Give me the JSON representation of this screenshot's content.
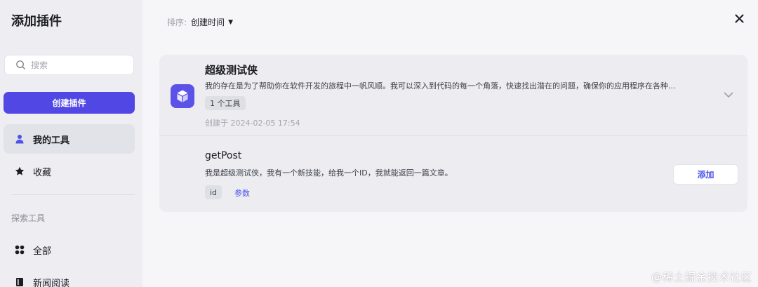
{
  "sidebar": {
    "title": "添加插件",
    "search_placeholder": "搜索",
    "create_button": "创建插件",
    "items": [
      {
        "label": "我的工具",
        "icon": "user-icon",
        "active": true
      },
      {
        "label": "收藏",
        "icon": "star-icon",
        "active": false
      }
    ],
    "section_label": "探索工具",
    "explore_items": [
      {
        "label": "全部",
        "icon": "grid-icon"
      },
      {
        "label": "新闻阅读",
        "icon": "book-icon"
      }
    ]
  },
  "main": {
    "sort_label": "排序:",
    "sort_value": "创建时间",
    "plugin": {
      "name": "超级测试侠",
      "description": "我的存在是为了帮助你在软件开发的旅程中一帆风顺。我可以深入到代码的每一个角落，快速找出潜在的问题，确保你的应用程序在各种...",
      "tool_count": "1 个工具",
      "created": "创建于 2024-02-05 17:54",
      "icon_color": "#5b52e8"
    },
    "tool": {
      "name": "getPost",
      "description": "我是超级测试侠，我有一个新技能，给我一个ID，我就能返回一篇文章。",
      "param": "id",
      "params_link": "参数",
      "add_button": "添加"
    }
  },
  "watermark": "@稀土掘金技术社区",
  "colors": {
    "accent": "#5147e5",
    "link": "#4d53e8",
    "sidebar_bg": "#ededf2",
    "page_bg": "#f6f6f9"
  }
}
